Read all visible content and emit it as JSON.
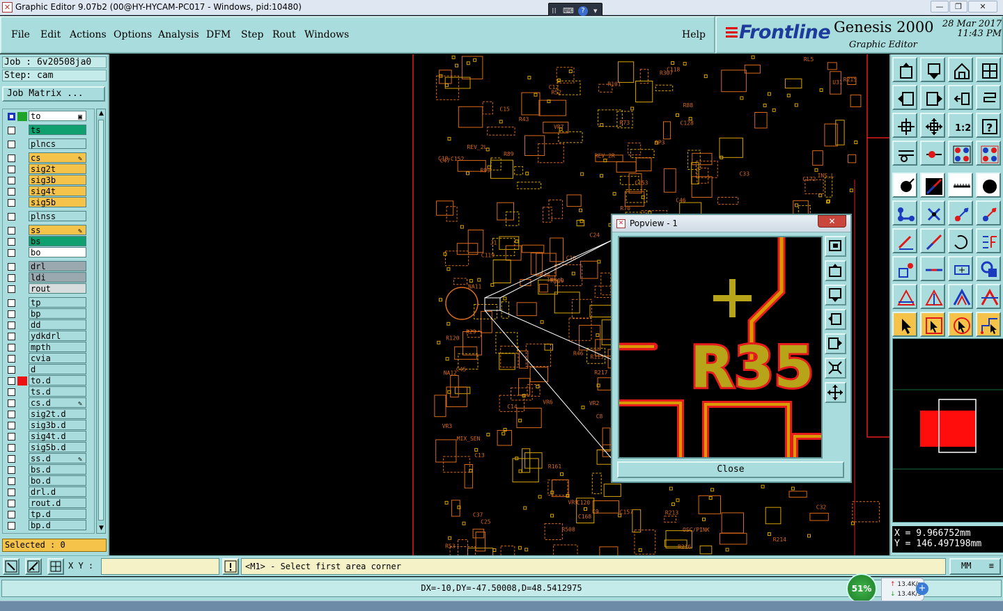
{
  "window": {
    "title": "Graphic Editor 9.07b2 (00@HY-HYCAM-PC017 - Windows, pid:10480)"
  },
  "menu": {
    "items": [
      "File",
      "Edit",
      "Actions",
      "Options",
      "Analysis",
      "DFM",
      "Step",
      "Rout",
      "Windows"
    ],
    "help": "Help"
  },
  "brand": {
    "logo": "Frontline",
    "product": "Genesis 2000",
    "subtitle": "Graphic Editor",
    "date": "28 Mar 2017",
    "time": "11:43 PM"
  },
  "job": {
    "job_line": "Job : 6v20508ja0",
    "step_line": "Step: cam",
    "matrix_button": "Job Matrix ..."
  },
  "layers": [
    {
      "name": "to",
      "bg": "#ffffff",
      "swatch": "#1fa32a",
      "selected": true,
      "flag": "▣"
    },
    {
      "name": "ts",
      "bg": "#10a070",
      "swatch": "",
      "selected": false,
      "flag": ""
    },
    {
      "name": "plncs",
      "bg": "#a9dcdc",
      "swatch": "",
      "selected": false,
      "flag": ""
    },
    {
      "name": "cs",
      "bg": "#f5c24a",
      "swatch": "",
      "selected": false,
      "flag": "✎"
    },
    {
      "name": "sig2t",
      "bg": "#f5c24a",
      "swatch": "",
      "selected": false,
      "flag": ""
    },
    {
      "name": "sig3b",
      "bg": "#f5c24a",
      "swatch": "",
      "selected": false,
      "flag": ""
    },
    {
      "name": "sig4t",
      "bg": "#f5c24a",
      "swatch": "",
      "selected": false,
      "flag": ""
    },
    {
      "name": "sig5b",
      "bg": "#f5c24a",
      "swatch": "",
      "selected": false,
      "flag": ""
    },
    {
      "name": "plnss",
      "bg": "#a9dcdc",
      "swatch": "",
      "selected": false,
      "flag": ""
    },
    {
      "name": "ss",
      "bg": "#f5c24a",
      "swatch": "",
      "selected": false,
      "flag": "✎"
    },
    {
      "name": "bs",
      "bg": "#10a070",
      "swatch": "",
      "selected": false,
      "flag": ""
    },
    {
      "name": "bo",
      "bg": "#ffffff",
      "swatch": "",
      "selected": false,
      "flag": ""
    },
    {
      "name": "drl",
      "bg": "#9aa8b0",
      "swatch": "",
      "selected": false,
      "flag": ""
    },
    {
      "name": "ldi",
      "bg": "#9aa8b0",
      "swatch": "",
      "selected": false,
      "flag": ""
    },
    {
      "name": "rout",
      "bg": "#d7dcdc",
      "swatch": "",
      "selected": false,
      "flag": ""
    },
    {
      "name": "tp",
      "bg": "#a9dcdc",
      "swatch": "",
      "selected": false,
      "flag": ""
    },
    {
      "name": "bp",
      "bg": "#a9dcdc",
      "swatch": "",
      "selected": false,
      "flag": ""
    },
    {
      "name": "dd",
      "bg": "#a9dcdc",
      "swatch": "",
      "selected": false,
      "flag": ""
    },
    {
      "name": "ydkdrl",
      "bg": "#a9dcdc",
      "swatch": "",
      "selected": false,
      "flag": ""
    },
    {
      "name": "mpth",
      "bg": "#a9dcdc",
      "swatch": "",
      "selected": false,
      "flag": ""
    },
    {
      "name": "cvia",
      "bg": "#a9dcdc",
      "swatch": "",
      "selected": false,
      "flag": ""
    },
    {
      "name": "d",
      "bg": "#a9dcdc",
      "swatch": "",
      "selected": false,
      "flag": ""
    },
    {
      "name": "to.d",
      "bg": "#a9dcdc",
      "swatch": "#ee1111",
      "selected": false,
      "flag": ""
    },
    {
      "name": "ts.d",
      "bg": "#a9dcdc",
      "swatch": "",
      "selected": false,
      "flag": ""
    },
    {
      "name": "cs.d",
      "bg": "#a9dcdc",
      "swatch": "",
      "selected": false,
      "flag": "✎"
    },
    {
      "name": "sig2t.d",
      "bg": "#a9dcdc",
      "swatch": "",
      "selected": false,
      "flag": ""
    },
    {
      "name": "sig3b.d",
      "bg": "#a9dcdc",
      "swatch": "",
      "selected": false,
      "flag": ""
    },
    {
      "name": "sig4t.d",
      "bg": "#a9dcdc",
      "swatch": "",
      "selected": false,
      "flag": ""
    },
    {
      "name": "sig5b.d",
      "bg": "#a9dcdc",
      "swatch": "",
      "selected": false,
      "flag": ""
    },
    {
      "name": "ss.d",
      "bg": "#a9dcdc",
      "swatch": "",
      "selected": false,
      "flag": "✎"
    },
    {
      "name": "bs.d",
      "bg": "#a9dcdc",
      "swatch": "",
      "selected": false,
      "flag": ""
    },
    {
      "name": "bo.d",
      "bg": "#a9dcdc",
      "swatch": "",
      "selected": false,
      "flag": ""
    },
    {
      "name": "drl.d",
      "bg": "#a9dcdc",
      "swatch": "",
      "selected": false,
      "flag": ""
    },
    {
      "name": "rout.d",
      "bg": "#a9dcdc",
      "swatch": "",
      "selected": false,
      "flag": ""
    },
    {
      "name": "tp.d",
      "bg": "#a9dcdc",
      "swatch": "",
      "selected": false,
      "flag": ""
    },
    {
      "name": "bp.d",
      "bg": "#a9dcdc",
      "swatch": "",
      "selected": false,
      "flag": ""
    }
  ],
  "selected_text": "Selected : 0",
  "popview": {
    "title": "Popview - 1",
    "close_x": "✕",
    "label": "R35",
    "close_button": "Close"
  },
  "board_labels": [
    "C13",
    "C18",
    "C14",
    "C37",
    "C15",
    "C9",
    "C24",
    "C32",
    "R161",
    "C128",
    "REV_2L",
    "C10",
    "C25",
    "C33",
    "R73",
    "R101",
    "RL5",
    "R120",
    "VR6",
    "REV_2R",
    "R53",
    "R43",
    "OSC/PINK",
    "VR9",
    "C34",
    "C8",
    "C157",
    "R508",
    "R509",
    "MIX_SEN",
    "VR3",
    "VR2",
    "NA11",
    "NA12",
    "R214",
    "C153",
    "INS_L",
    "R52",
    "R307",
    "C168",
    "R29",
    "R213",
    "C152",
    "R46",
    "C12",
    "C47",
    "R88",
    "R89",
    "VR7",
    "INS_L",
    "R115",
    "R99",
    "C46",
    "J1",
    "C120",
    "U31",
    "C118",
    "C119",
    "C172",
    "R216",
    "R217",
    "R215",
    "SP3",
    "C45",
    "R70"
  ],
  "coords": {
    "x": "X = 9.966752mm",
    "y": "Y = 146.497198mm"
  },
  "cmdbar": {
    "xy_label": "X Y :",
    "xy_value": "",
    "prompt": "<M1> - Select first area corner",
    "units": "MM"
  },
  "status": {
    "measure": "DX=-10,DY=-47.50008,D=48.5412975"
  },
  "network": {
    "percent": "51%",
    "up": "13.4K/s",
    "down": "13.4K/s"
  },
  "colors": {
    "panel": "#a9dcdc",
    "copper": "#e8a000",
    "pad_red": "#e61c1c",
    "highlight": "#f5c24a"
  }
}
